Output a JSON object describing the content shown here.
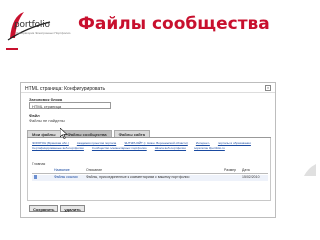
{
  "slide": {
    "logo_text": "portfolio",
    "logo_tag": "Лаборатория Электронных Портфолио",
    "title": "Файлы сообщества"
  },
  "window": {
    "title": "HTML страница: Конфигурировать",
    "close": "×"
  },
  "form": {
    "block_title_label": "Заголовок блока",
    "block_title_value": "HTML страница",
    "file_label": "Файл",
    "file_value": "Файлы не найдены"
  },
  "tabs": [
    {
      "label": "Мои файлы",
      "active": false
    },
    {
      "label": "Файлы сообщества",
      "active": true
    },
    {
      "label": "Файлы сайта",
      "active": false
    }
  ],
  "communities": [
    "ЭОРАТОН (Брянская обл.)",
    "Академия проектов портала",
    "ЭНТЭРНЭЙТ (г. Нижн. Воронежской области)",
    "Интернет-",
    "порталы в образовании",
    "Сертифицированные веб-портфолио",
    "Сообщество элементарных портфолио",
    "Школа веб-портфолио",
    "эорататон #portfolio.ru"
  ],
  "breadcrumb": "Главная",
  "files_table": {
    "headers": [
      "Название",
      "Описание",
      "Размер",
      "Дата"
    ],
    "rows": [
      {
        "name": "Файлы ссылки",
        "description": "Файлы, присоединенные к комментариям с вашему портфолио",
        "size": "",
        "date": "15/02/2010"
      }
    ]
  },
  "buttons": {
    "save": "Сохранить",
    "delete": "удалить"
  },
  "colors": {
    "title_red": "#c8102e",
    "link_blue": "#1a4aa0"
  }
}
